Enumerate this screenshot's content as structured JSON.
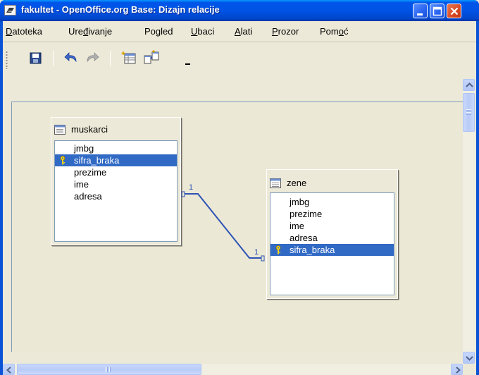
{
  "window": {
    "title": "fakultet - OpenOffice.org Base: Dizajn relacije",
    "icons": {
      "app": "openoffice-icon",
      "minimize": "minimize-icon",
      "maximize": "maximize-icon",
      "close": "close-icon"
    }
  },
  "menubar": {
    "items": [
      {
        "pre": "",
        "ul": "D",
        "post": "atoteka"
      },
      {
        "pre": "Ure",
        "ul": "đ",
        "post": "ivanje"
      },
      {
        "pre": "Po",
        "ul": "g",
        "post": "led"
      },
      {
        "pre": "",
        "ul": "U",
        "post": "baci"
      },
      {
        "pre": "",
        "ul": "A",
        "post": "lati"
      },
      {
        "pre": "",
        "ul": "P",
        "post": "rozor"
      },
      {
        "pre": "Pom",
        "ul": "o",
        "post": "ć"
      }
    ]
  },
  "toolbar": {
    "icons": [
      "save-icon",
      "undo-icon",
      "redo-icon",
      "add-table-icon",
      "new-relation-icon",
      "toolbar-options-icon"
    ]
  },
  "tables": [
    {
      "name": "muskarci",
      "fields": [
        "jmbg",
        "sifra_braka",
        "prezime",
        "ime",
        "adresa"
      ],
      "key_field": "sifra_braka",
      "selected_field": "sifra_braka"
    },
    {
      "name": "zene",
      "fields": [
        "jmbg",
        "prezime",
        "ime",
        "adresa",
        "sifra_braka"
      ],
      "key_field": "sifra_braka",
      "selected_field": "sifra_braka"
    }
  ],
  "relation": {
    "from_table": "muskarci",
    "from_field": "sifra_braka",
    "to_table": "zene",
    "to_field": "sifra_braka",
    "from_cardinality": "1",
    "to_cardinality": "1"
  },
  "colors": {
    "titlebar": "#0053e4",
    "selection": "#316ac5",
    "relation_line": "#2d53b5",
    "canvas": "#ebe8d5"
  }
}
